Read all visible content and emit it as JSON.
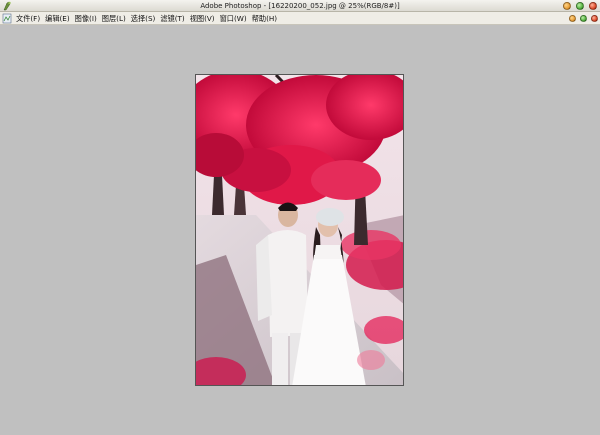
{
  "window": {
    "title": "Adobe Photoshop - [16220200_052.jpg @ 25%(RGB/8#)]",
    "app_icon": "photoshop-app-icon"
  },
  "window_controls": [
    "minimize-icon",
    "maximize-icon",
    "close-icon"
  ],
  "menu": {
    "items": [
      {
        "label": "文件(F)"
      },
      {
        "label": "编辑(E)"
      },
      {
        "label": "图像(I)"
      },
      {
        "label": "图层(L)"
      },
      {
        "label": "选择(S)"
      },
      {
        "label": "滤镜(T)"
      },
      {
        "label": "视图(V)"
      },
      {
        "label": "窗口(W)"
      },
      {
        "label": "帮助(H)"
      }
    ]
  },
  "colors": {
    "workspace": "#c0c0c0",
    "btn_min": "#e9a13b",
    "btn_max": "#58b543",
    "btn_close": "#e0502f"
  },
  "document": {
    "image": "wedding-photo-couple-under-red-tree"
  }
}
